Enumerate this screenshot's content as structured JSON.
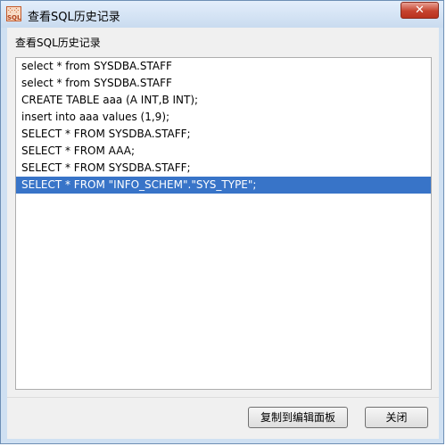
{
  "window": {
    "title": "查看SQL历史记录",
    "close_glyph": "✕",
    "icon_text": "SQL"
  },
  "history": {
    "label": "查看SQL历史记录",
    "items": [
      "select * from SYSDBA.STAFF",
      "select * from SYSDBA.STAFF",
      "CREATE TABLE aaa (A INT,B INT);",
      "insert into aaa values (1,9);",
      "SELECT * FROM SYSDBA.STAFF;",
      "SELECT * FROM AAA;",
      "SELECT * FROM SYSDBA.STAFF;",
      "SELECT * FROM \"INFO_SCHEM\".\"SYS_TYPE\";"
    ],
    "selected_index": 7
  },
  "buttons": {
    "copy_label": "复制到编辑面板",
    "close_label": "关闭"
  },
  "colors": {
    "selection": "#3874c8",
    "close_button": "#c6432e"
  }
}
